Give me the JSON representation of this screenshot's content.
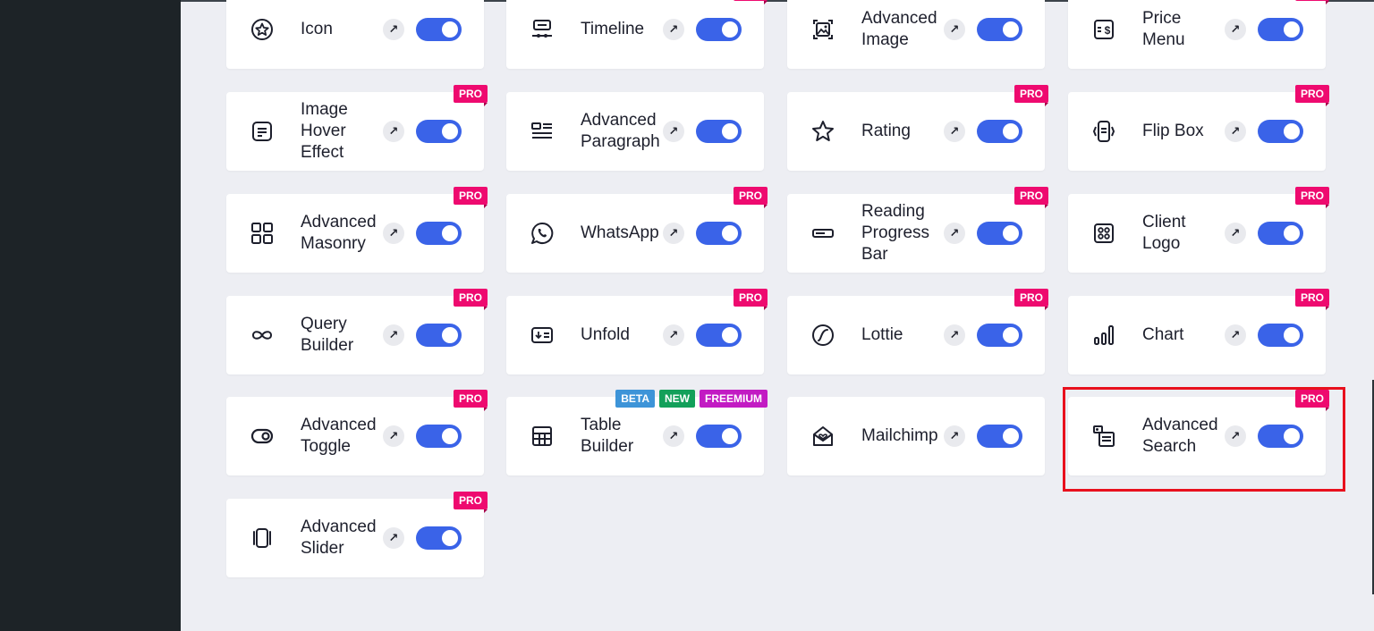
{
  "colors": {
    "sidebar": "#1d2327",
    "background": "#edeef3",
    "toggle_on": "#3a63e8",
    "pro_badge": "#ee0a6f",
    "beta_badge": "#3d94d8",
    "new_badge": "#13a05a",
    "freemium_badge": "#c21bc3",
    "highlight": "#e8101d"
  },
  "widgets": [
    {
      "label": "Icon",
      "icon": "star-circle-icon",
      "badges": [],
      "enabled": true
    },
    {
      "label": "Timeline",
      "icon": "timeline-icon",
      "badges": [
        "PRO"
      ],
      "enabled": true
    },
    {
      "label": "Advanced\nImage",
      "icon": "image-icon",
      "badges": [],
      "enabled": true
    },
    {
      "label": "Price\nMenu",
      "icon": "price-menu-icon",
      "badges": [
        "PRO"
      ],
      "enabled": true
    },
    {
      "label": "Image\nHover\nEffect",
      "icon": "image-hover-icon",
      "badges": [
        "PRO"
      ],
      "enabled": true
    },
    {
      "label": "Advanced\nParagraph",
      "icon": "paragraph-icon",
      "badges": [],
      "enabled": true
    },
    {
      "label": "Rating",
      "icon": "star-icon",
      "badges": [
        "PRO"
      ],
      "enabled": true
    },
    {
      "label": "Flip Box",
      "icon": "flip-box-icon",
      "badges": [
        "PRO"
      ],
      "enabled": true
    },
    {
      "label": "Advanced\nMasonry",
      "icon": "masonry-grid-icon",
      "badges": [
        "PRO"
      ],
      "enabled": true
    },
    {
      "label": "WhatsApp",
      "icon": "whatsapp-icon",
      "badges": [
        "PRO"
      ],
      "enabled": true
    },
    {
      "label": "Reading\nProgress\nBar",
      "icon": "progress-bar-icon",
      "badges": [
        "PRO"
      ],
      "enabled": true
    },
    {
      "label": "Client\nLogo",
      "icon": "client-logo-icon",
      "badges": [
        "PRO"
      ],
      "enabled": true
    },
    {
      "label": "Query\nBuilder",
      "icon": "infinity-icon",
      "badges": [
        "PRO"
      ],
      "enabled": true
    },
    {
      "label": "Unfold",
      "icon": "unfold-icon",
      "badges": [
        "PRO"
      ],
      "enabled": true
    },
    {
      "label": "Lottie",
      "icon": "lottie-icon",
      "badges": [
        "PRO"
      ],
      "enabled": true
    },
    {
      "label": "Chart",
      "icon": "bar-chart-icon",
      "badges": [
        "PRO"
      ],
      "enabled": true
    },
    {
      "label": "Advanced\nToggle",
      "icon": "toggle-icon",
      "badges": [
        "PRO"
      ],
      "enabled": true
    },
    {
      "label": "Table\nBuilder",
      "icon": "table-icon",
      "badges": [
        "BETA",
        "NEW",
        "FREEMIUM"
      ],
      "enabled": true
    },
    {
      "label": "Mailchimp",
      "icon": "mail-envelope-icon",
      "badges": [],
      "enabled": true
    },
    {
      "label": "Advanced\nSearch",
      "icon": "search-form-icon",
      "badges": [
        "PRO"
      ],
      "enabled": true,
      "highlighted": true
    },
    {
      "label": "Advanced\nSlider",
      "icon": "slider-icon",
      "badges": [
        "PRO"
      ],
      "enabled": true
    }
  ],
  "ui": {
    "external_link_glyph": "↗"
  }
}
